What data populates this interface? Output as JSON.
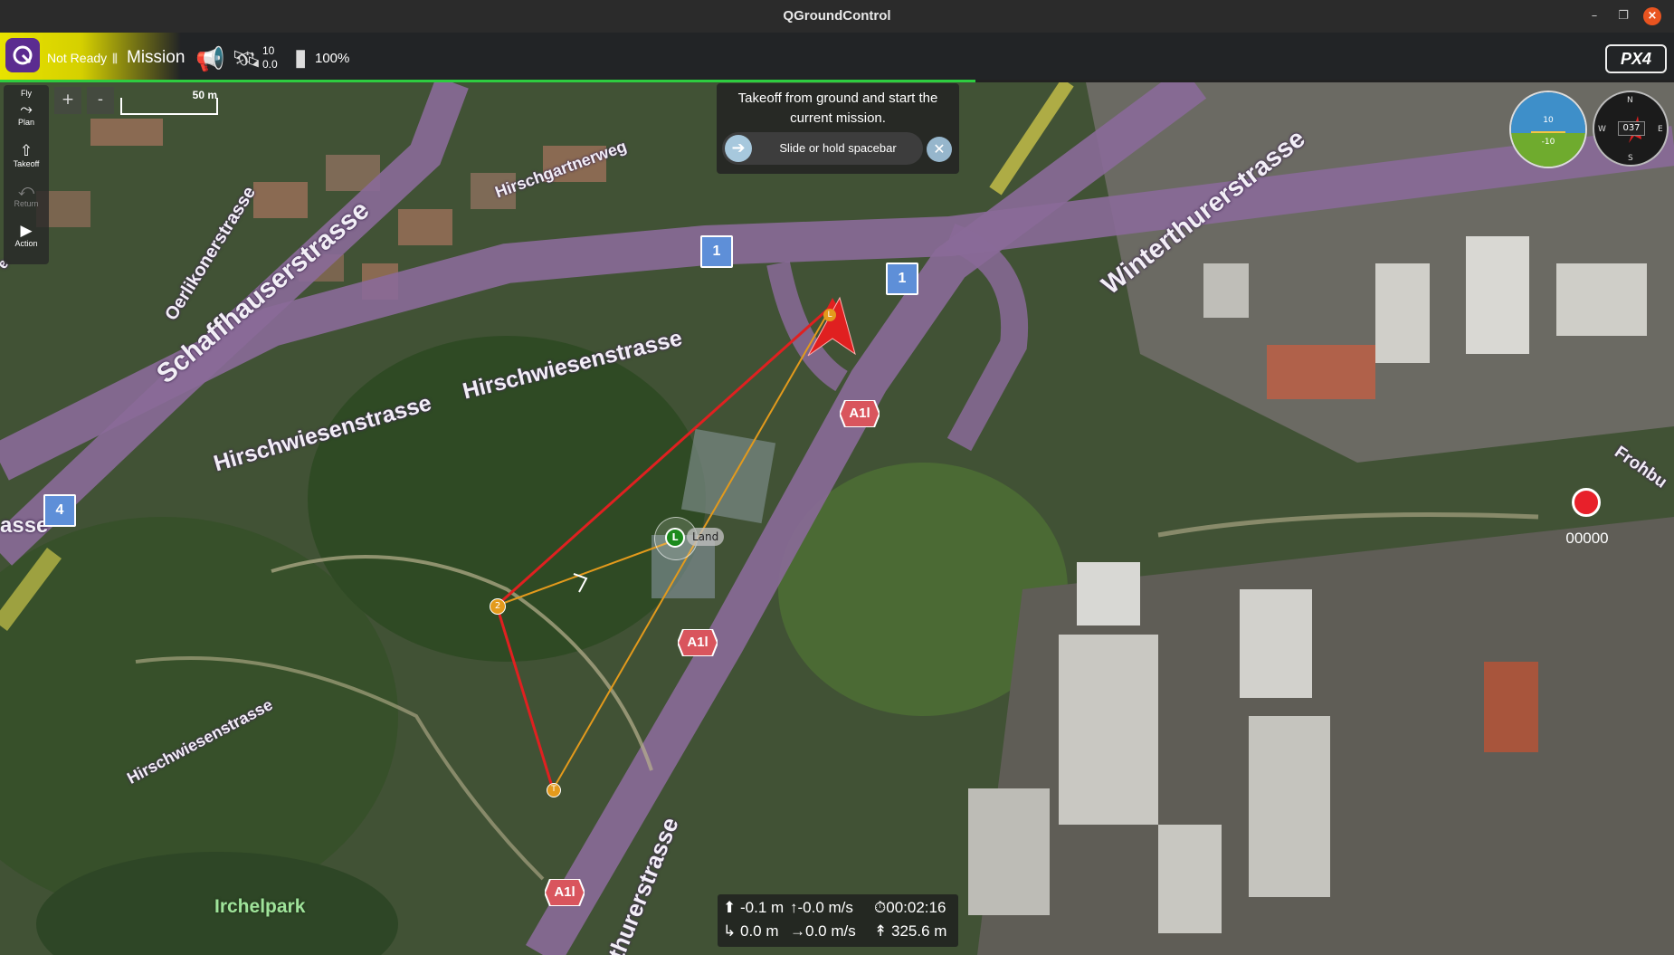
{
  "window": {
    "title": "QGroundControl"
  },
  "toolbar": {
    "status": "Not Ready",
    "mode": "Mission",
    "satellite_count": "10",
    "hdop": "0.0",
    "battery": "100%",
    "brand": "PX4"
  },
  "tools": [
    {
      "label": "Fly",
      "icon": "fly-icon"
    },
    {
      "label": "Plan",
      "icon": "plan-icon"
    },
    {
      "label": "Takeoff",
      "icon": "takeoff-icon"
    },
    {
      "label": "Return",
      "icon": "return-icon"
    },
    {
      "label": "Action",
      "icon": "action-icon"
    }
  ],
  "map": {
    "zoom_in": "+",
    "zoom_out": "-",
    "scale": "50 m",
    "roads": {
      "hirschgartnerweg": "Hirschgartnerweg",
      "oerlikonerstrasse": "Oerlikonerstrasse",
      "schaffhauserstrasse": "Schaffhauserstrasse",
      "hirschwiesenstrasse_1": "Hirschwiesenstrasse",
      "hirschwiesenstrasse_2": "Hirschwiesenstrasse",
      "hirschwiesenstrasse_3": "Hirschwiesenstrasse",
      "winterthurerstrasse": "Winterthurerstrasse",
      "frohburg": "Frohbu",
      "asse": "asse",
      "thurerstrasse": "thurerstrasse",
      "e_left": "e"
    },
    "park": "Irchelpark",
    "route_shields": [
      "1",
      "1",
      "4"
    ],
    "a1l": [
      "A1l",
      "A1l",
      "A1l"
    ],
    "waypoints": {
      "land_marker": "L",
      "land_label": "Land",
      "wp2": "2",
      "takeoff": "T",
      "vehicle_marker": "L"
    }
  },
  "takeoff_panel": {
    "message": "Takeoff from ground and start the current mission.",
    "slider_text": "Slide or hold spacebar"
  },
  "instruments": {
    "heading": "037",
    "att_upper": "10",
    "att_lower": "-10",
    "compass": [
      "N",
      "E",
      "S",
      "W"
    ]
  },
  "recording": {
    "counter": "00000"
  },
  "telemetry": {
    "altitude": "-0.1 m",
    "vertical_speed": "-0.0 m/s",
    "flight_time": "00:02:16",
    "distance": "0.0 m",
    "ground_speed": "0.0 m/s",
    "home_distance": "325.6 m"
  },
  "colors": {
    "accent_yellow": "#e9e300",
    "progress_green": "#2ecc40",
    "route_red": "#e02020",
    "route_orange": "#e39a1c"
  }
}
